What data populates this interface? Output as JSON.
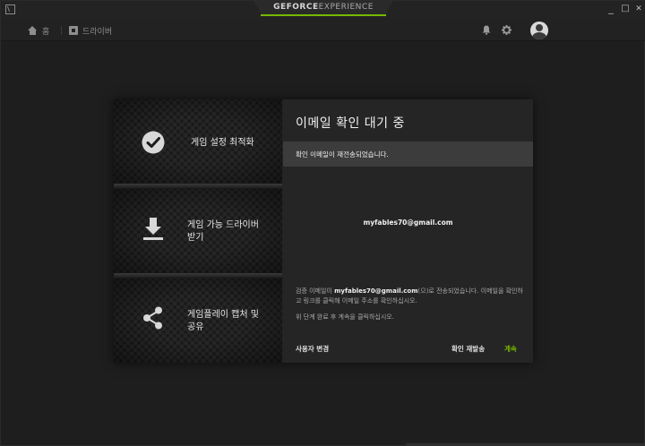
{
  "window": {
    "brand_main": "GEFORCE",
    "brand_sub": "EXPERIENCE",
    "minimize": "_",
    "maximize": "□",
    "close": "✕"
  },
  "nav": {
    "home_label": "홈",
    "drivers_label": "드라이버",
    "icons": [
      "home-icon",
      "driver-icon",
      "bell-icon",
      "gear-icon",
      "avatar-icon"
    ]
  },
  "features": [
    {
      "label": "게임 설정 최적화",
      "icon": "checkmark-icon"
    },
    {
      "label": "게임 가능 드라이버 받기",
      "icon": "download-icon"
    },
    {
      "label": "게임플레이 캡처 및 공유",
      "icon": "share-icon"
    }
  ],
  "dialog": {
    "title": "이메일 확인 대기 중",
    "notice": "확인 이메일이 재전송되었습니다.",
    "email": "myfables70@gmail.com",
    "body_prefix": "검증 이메일이 ",
    "body_email": "myfables70@gmail.com",
    "body_suffix": "(으)로 전송되었습니다. 이메일을 확인하고 링크를 클릭해 이메일 주소를 확인하십시오.",
    "body_line2": "위 단계 완료 후 계속을 클릭하십시오.",
    "change_user": "사용자 변경",
    "resend": "확인 재발송",
    "continue": "계속"
  },
  "colors": {
    "accent": "#76b900",
    "background": "#1e1e1e",
    "panel": "#252525"
  }
}
